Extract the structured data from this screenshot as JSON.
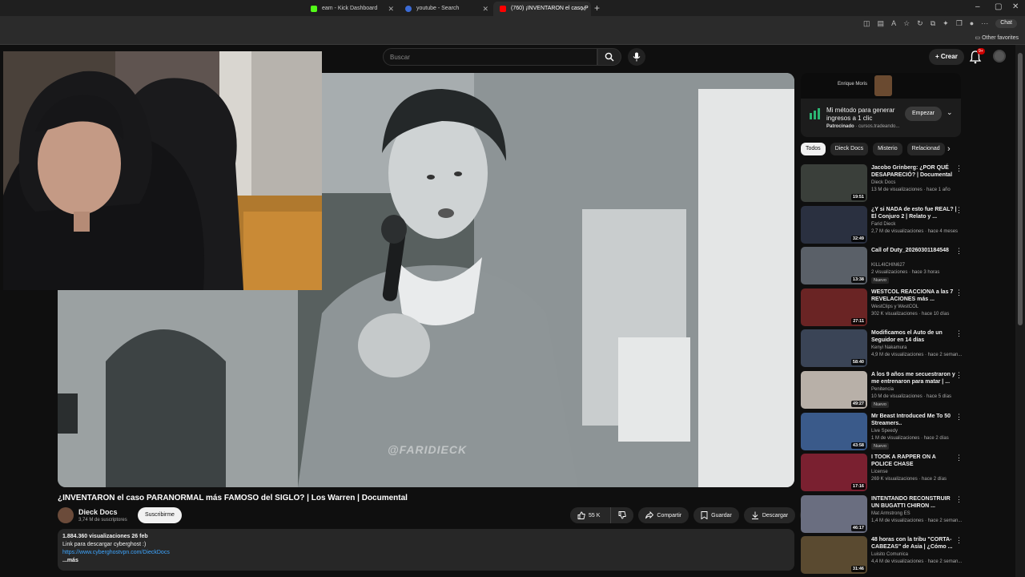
{
  "browser": {
    "tabs": [
      {
        "title": "eam - Kick Dashboard",
        "active": false
      },
      {
        "title": "youtube - Search",
        "active": false
      },
      {
        "title": "(760) ¡INVENTARON el caso P",
        "active": true
      }
    ],
    "chat_label": "Chat",
    "other_favorites": "Other favorites"
  },
  "youtube": {
    "search_placeholder": "Buscar",
    "create_label": "Crear",
    "notif_count": "9+",
    "video": {
      "title": "¿INVENTARON el caso PARANORMAL más FAMOSO del SIGLO? | Los Warren | Documental",
      "watermark": "@FARIDIECK",
      "channel": "Dieck Docs",
      "subscribers": "3,74 M de suscriptores",
      "subscribe_label": "Suscribirme",
      "likes": "55 K",
      "share_label": "Compartir",
      "save_label": "Guardar",
      "download_label": "Descargar",
      "stats": "1.884.360 visualizaciones  26 feb",
      "desc_line1": "Link para descargar cyberghost :)",
      "desc_link": "https://www.cyberghostvpn.com/DieckDocs",
      "more_label": "...más"
    },
    "ad": {
      "brand": "Enrique Moris",
      "text": "Mi método para generar ingresos a 1 clic",
      "sponsored": "Patrocinado",
      "domain": "· cursos.tradeando...",
      "button": "Empezar"
    },
    "chips": [
      "Todos",
      "Dieck Docs",
      "Misterio",
      "Relacionad"
    ],
    "recommendations": [
      {
        "title": "Jacobo Grinberg: ¿POR QUÉ DESAPARECIÓ? | Documental",
        "channel": "Dieck Docs",
        "meta": "13 M de visualizaciones · hace 1 año",
        "duration": "19:51",
        "badge": "",
        "color": "#3a3f3a"
      },
      {
        "title": "¿Y si NADA de esto fue REAL? | El Conjuro 2 | Relato y ...",
        "channel": "Farid Dieck",
        "meta": "2,7 M de visualizaciones · hace 4 meses",
        "duration": "32:49",
        "badge": "",
        "color": "#2a3040"
      },
      {
        "title": "Call of Duty_20260301184548",
        "channel": "KILL4ICHIN627",
        "meta": "2 visualizaciones · hace 3 horas",
        "duration": "13:38",
        "badge": "Nuevo",
        "color": "#5a6068"
      },
      {
        "title": "WESTCOL REACCIONA a las 7 REVELACIONES más ...",
        "channel": "WestClips  y WestCOL",
        "meta": "302 K visualizaciones · hace 10 días",
        "duration": "27:11",
        "badge": "",
        "color": "#6a2424"
      },
      {
        "title": "Modificamos el Auto de un Seguidor en 14 días",
        "channel": "Kenyi Nakamura",
        "meta": "4,9 M de visualizaciones · hace 2 seman...",
        "duration": "58:40",
        "badge": "",
        "color": "#3a4456"
      },
      {
        "title": "A los 9 años me secuestraron y me entrenaron para matar | ...",
        "channel": "Penitencia",
        "meta": "10 M de visualizaciones · hace 5 días",
        "duration": "49:27",
        "badge": "Nuevo",
        "color": "#b8b0a8"
      },
      {
        "title": "Mr Beast Introduced Me To 50 Streamers..",
        "channel": "Live Speedy",
        "meta": "1 M de visualizaciones · hace 2 días",
        "duration": "43:58",
        "badge": "Nuevo",
        "color": "#3a5a8a"
      },
      {
        "title": "I TOOK A RAPPER ON A POLICE CHASE",
        "channel": "License",
        "meta": "269 K visualizaciones · hace 2 días",
        "duration": "17:16",
        "badge": "",
        "color": "#7a2030"
      },
      {
        "title": "INTENTANDO RECONSTRUIR UN BUGATTI CHIRON ...",
        "channel": "Mat Armstrong ES",
        "meta": "1,4 M de visualizaciones · hace 2 seman...",
        "duration": "46:17",
        "badge": "",
        "color": "#6a6e80"
      },
      {
        "title": "48 horas con la tribu \"CORTA-CABEZAS\" de Asia | ¿Cómo ...",
        "channel": "Luisito Comunica",
        "meta": "4,4 M de visualizaciones · hace 2 seman...",
        "duration": "31:46",
        "badge": "",
        "color": "#5a4a30"
      }
    ]
  }
}
